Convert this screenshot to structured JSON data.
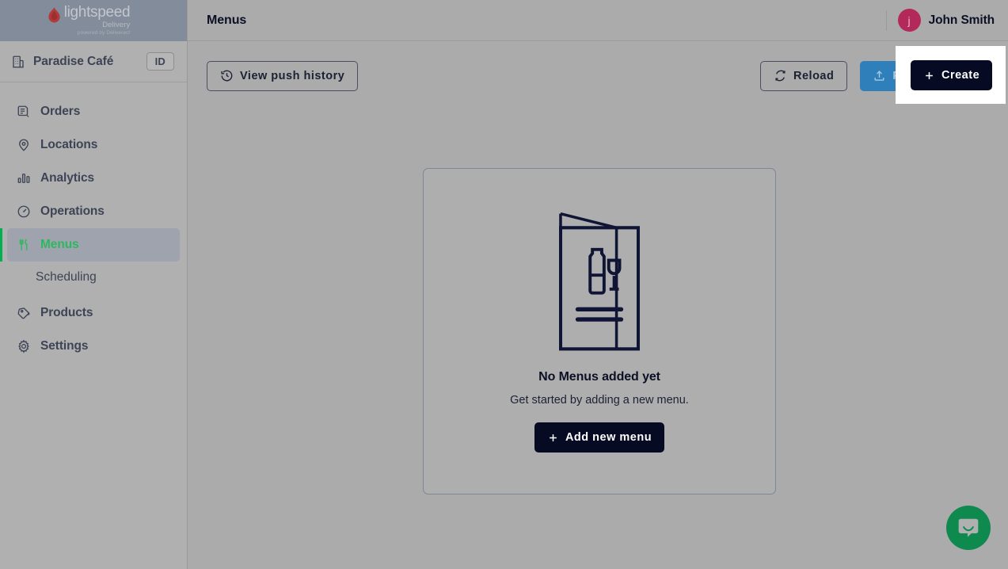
{
  "brand": {
    "logo_word": "lightspeed",
    "logo_sub": "Delivery",
    "logo_sub2": "powered by Deliverect",
    "accent_green": "#00b050",
    "accent_blue": "#2f7fbb",
    "accent_dark": "#060a22",
    "avatar_color": "#b3295a"
  },
  "sidebar": {
    "store": {
      "name": "Paradise Café",
      "icon": "building-icon",
      "badge": "ID"
    },
    "items": [
      {
        "label": "Orders",
        "icon": "orders-icon",
        "active": false
      },
      {
        "label": "Locations",
        "icon": "location-pin-icon",
        "active": false
      },
      {
        "label": "Analytics",
        "icon": "bar-chart-icon",
        "active": false
      },
      {
        "label": "Operations",
        "icon": "gauge-icon",
        "active": false
      },
      {
        "label": "Menus",
        "icon": "cutlery-icon",
        "active": true
      },
      {
        "label": "Products",
        "icon": "tag-icon",
        "active": false
      },
      {
        "label": "Settings",
        "icon": "gear-icon",
        "active": false
      }
    ],
    "sub_items": [
      {
        "label": "Scheduling",
        "parent": "Menus"
      }
    ]
  },
  "header": {
    "title": "Menus",
    "user": {
      "name": "John Smith",
      "avatar_initial": "j"
    }
  },
  "toolbar": {
    "view_push_history": "View push history",
    "view_push_history_icon": "history-clock-icon",
    "reload": "Reload",
    "reload_icon": "refresh-icon",
    "publish_menus": "Publish menus",
    "publish_menus_icon": "upload-icon",
    "publish_menus_disabled": true,
    "create": "Create",
    "create_icon": "plus-icon",
    "create_highlighted": true
  },
  "empty_state": {
    "illustration": "menu-card-bottle-glass-icon",
    "title": "No Menus added yet",
    "subtitle": "Get started by adding a new menu.",
    "cta_label": "Add new menu",
    "cta_icon": "plus-icon"
  },
  "support": {
    "widget": "intercom-chat-icon",
    "color": "#0e8a4f"
  }
}
